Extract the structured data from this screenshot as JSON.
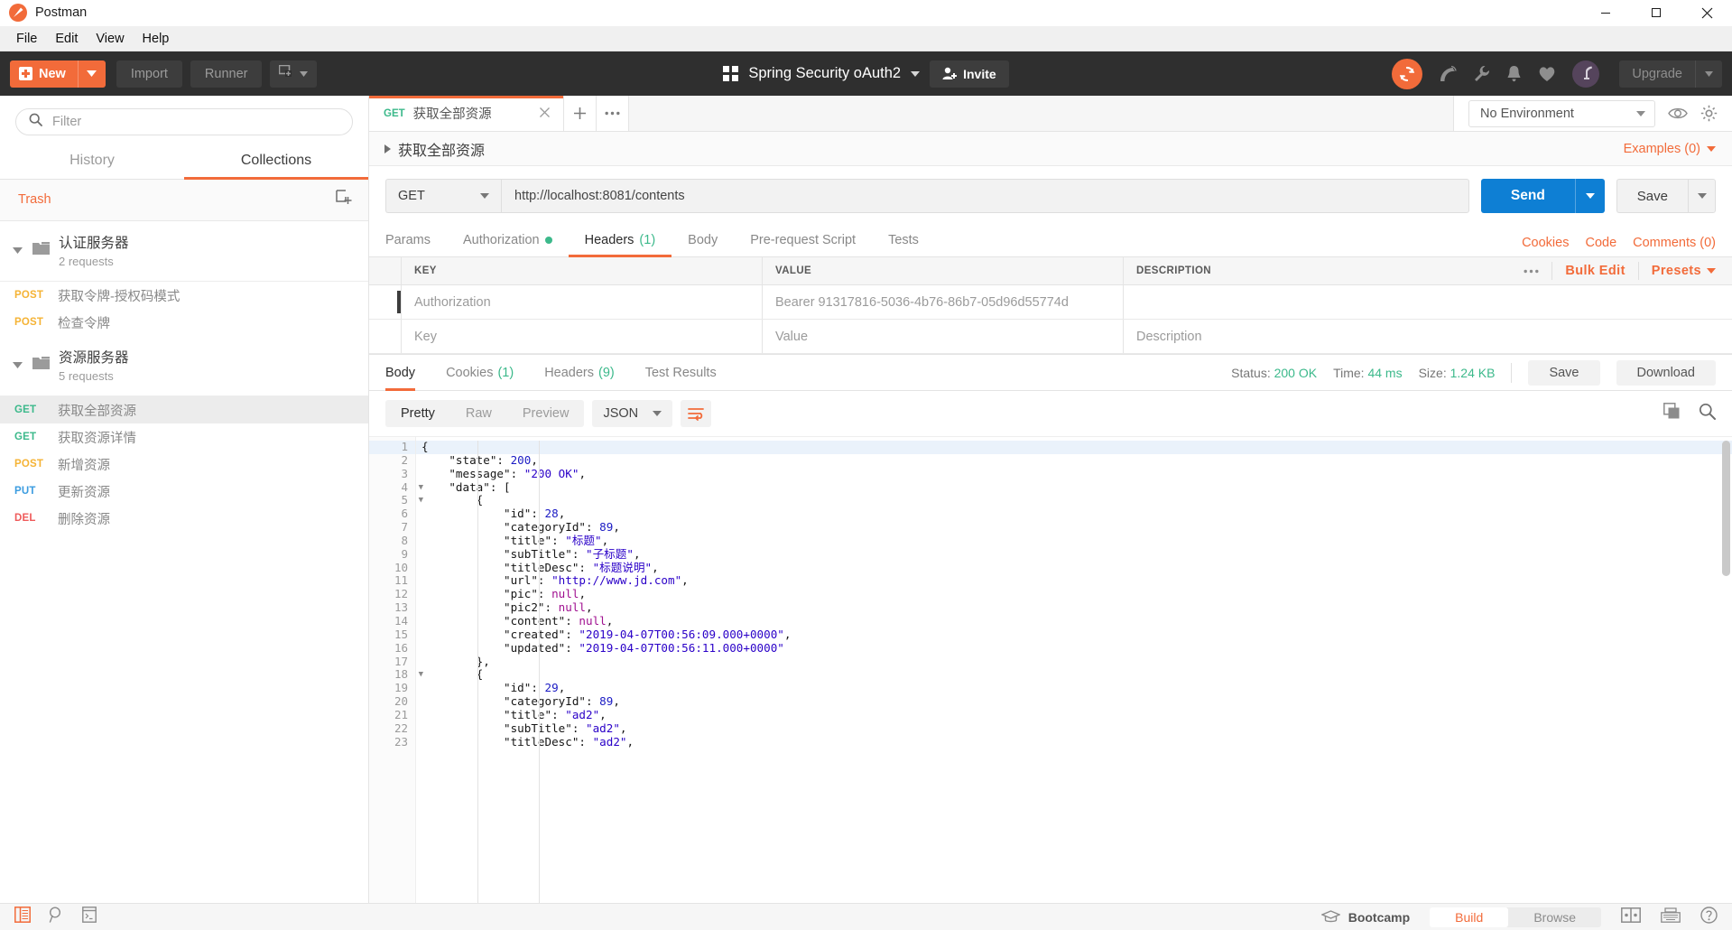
{
  "window": {
    "title": "Postman",
    "minimize_label": "minimize-window",
    "maximize_label": "maximize-window",
    "close_label": "close-window"
  },
  "menubar": {
    "items": [
      "File",
      "Edit",
      "View",
      "Help"
    ]
  },
  "appheader": {
    "new_label": "New",
    "import_label": "Import",
    "runner_label": "Runner",
    "workspace_name": "Spring Security oAuth2",
    "invite_label": "Invite",
    "upgrade_label": "Upgrade"
  },
  "sidebar": {
    "filter_placeholder": "Filter",
    "tabs": [
      {
        "label": "History",
        "active": false
      },
      {
        "label": "Collections",
        "active": true
      }
    ],
    "trash_label": "Trash",
    "collections": [
      {
        "name": "认证服务器",
        "count": "2 requests",
        "requests": [
          {
            "method": "POST",
            "name": "获取令牌-授权码模式",
            "active": false
          },
          {
            "method": "POST",
            "name": "检查令牌",
            "active": false
          }
        ]
      },
      {
        "name": "资源服务器",
        "count": "5 requests",
        "requests": [
          {
            "method": "GET",
            "name": "获取全部资源",
            "active": true
          },
          {
            "method": "GET",
            "name": "获取资源详情",
            "active": false
          },
          {
            "method": "POST",
            "name": "新增资源",
            "active": false
          },
          {
            "method": "PUT",
            "name": "更新资源",
            "active": false
          },
          {
            "method": "DEL",
            "name": "删除资源",
            "active": false
          }
        ]
      }
    ]
  },
  "tabstrip": {
    "open_tab": {
      "method": "GET",
      "name": "获取全部资源"
    },
    "new_tab_label": "+",
    "more_label": "•••",
    "environment": "No Environment"
  },
  "request": {
    "name": "获取全部资源",
    "examples_label": "Examples (0)",
    "method": "GET",
    "url": "http://localhost:8081/contents",
    "send_label": "Send",
    "save_label": "Save",
    "tabs": [
      {
        "label": "Params",
        "active": false,
        "dot": false,
        "count": ""
      },
      {
        "label": "Authorization",
        "active": false,
        "dot": true,
        "count": ""
      },
      {
        "label": "Headers",
        "active": true,
        "dot": false,
        "count": "(1)"
      },
      {
        "label": "Body",
        "active": false,
        "dot": false,
        "count": ""
      },
      {
        "label": "Pre-request Script",
        "active": false,
        "dot": false,
        "count": ""
      },
      {
        "label": "Tests",
        "active": false,
        "dot": false,
        "count": ""
      }
    ],
    "links": [
      "Cookies",
      "Code",
      "Comments (0)"
    ],
    "headers_table": {
      "columns": [
        "KEY",
        "VALUE",
        "DESCRIPTION"
      ],
      "actions": {
        "more": "•••",
        "bulk_edit": "Bulk Edit",
        "presets": "Presets"
      },
      "rows": [
        {
          "key": "Authorization",
          "value": "Bearer 91317816-5036-4b76-86b7-05d96d55774d",
          "description": "",
          "filled": true
        },
        {
          "key": "Key",
          "value": "Value",
          "description": "Description",
          "filled": false
        }
      ]
    }
  },
  "response": {
    "tabs": [
      {
        "label": "Body",
        "count": "",
        "active": true
      },
      {
        "label": "Cookies",
        "count": "(1)",
        "active": false
      },
      {
        "label": "Headers",
        "count": "(9)",
        "active": false
      },
      {
        "label": "Test Results",
        "count": "",
        "active": false
      }
    ],
    "status_label": "Status:",
    "status_value": "200 OK",
    "time_label": "Time:",
    "time_value": "44 ms",
    "size_label": "Size:",
    "size_value": "1.24 KB",
    "save_label": "Save",
    "download_label": "Download",
    "view_modes": [
      {
        "label": "Pretty",
        "active": true
      },
      {
        "label": "Raw",
        "active": false
      },
      {
        "label": "Preview",
        "active": false
      }
    ],
    "format": "JSON",
    "body_lines": [
      {
        "n": 1,
        "fold": true,
        "indent": 0,
        "tokens": [
          {
            "t": "p",
            "v": "{"
          }
        ]
      },
      {
        "n": 2,
        "fold": false,
        "indent": 1,
        "tokens": [
          {
            "t": "k",
            "v": "\"state\""
          },
          {
            "t": "p",
            "v": ": "
          },
          {
            "t": "n",
            "v": "200"
          },
          {
            "t": "p",
            "v": ","
          }
        ]
      },
      {
        "n": 3,
        "fold": false,
        "indent": 1,
        "tokens": [
          {
            "t": "k",
            "v": "\"message\""
          },
          {
            "t": "p",
            "v": ": "
          },
          {
            "t": "s",
            "v": "\"200 OK\""
          },
          {
            "t": "p",
            "v": ","
          }
        ]
      },
      {
        "n": 4,
        "fold": true,
        "indent": 1,
        "tokens": [
          {
            "t": "k",
            "v": "\"data\""
          },
          {
            "t": "p",
            "v": ": ["
          }
        ]
      },
      {
        "n": 5,
        "fold": true,
        "indent": 2,
        "tokens": [
          {
            "t": "p",
            "v": "{"
          }
        ]
      },
      {
        "n": 6,
        "fold": false,
        "indent": 3,
        "tokens": [
          {
            "t": "k",
            "v": "\"id\""
          },
          {
            "t": "p",
            "v": ": "
          },
          {
            "t": "n",
            "v": "28"
          },
          {
            "t": "p",
            "v": ","
          }
        ]
      },
      {
        "n": 7,
        "fold": false,
        "indent": 3,
        "tokens": [
          {
            "t": "k",
            "v": "\"categoryId\""
          },
          {
            "t": "p",
            "v": ": "
          },
          {
            "t": "n",
            "v": "89"
          },
          {
            "t": "p",
            "v": ","
          }
        ]
      },
      {
        "n": 8,
        "fold": false,
        "indent": 3,
        "tokens": [
          {
            "t": "k",
            "v": "\"title\""
          },
          {
            "t": "p",
            "v": ": "
          },
          {
            "t": "s",
            "v": "\"标题\""
          },
          {
            "t": "p",
            "v": ","
          }
        ]
      },
      {
        "n": 9,
        "fold": false,
        "indent": 3,
        "tokens": [
          {
            "t": "k",
            "v": "\"subTitle\""
          },
          {
            "t": "p",
            "v": ": "
          },
          {
            "t": "s",
            "v": "\"子标题\""
          },
          {
            "t": "p",
            "v": ","
          }
        ]
      },
      {
        "n": 10,
        "fold": false,
        "indent": 3,
        "tokens": [
          {
            "t": "k",
            "v": "\"titleDesc\""
          },
          {
            "t": "p",
            "v": ": "
          },
          {
            "t": "s",
            "v": "\"标题说明\""
          },
          {
            "t": "p",
            "v": ","
          }
        ]
      },
      {
        "n": 11,
        "fold": false,
        "indent": 3,
        "tokens": [
          {
            "t": "k",
            "v": "\"url\""
          },
          {
            "t": "p",
            "v": ": "
          },
          {
            "t": "s",
            "v": "\"http://www.jd.com\""
          },
          {
            "t": "p",
            "v": ","
          }
        ]
      },
      {
        "n": 12,
        "fold": false,
        "indent": 3,
        "tokens": [
          {
            "t": "k",
            "v": "\"pic\""
          },
          {
            "t": "p",
            "v": ": "
          },
          {
            "t": "nl",
            "v": "null"
          },
          {
            "t": "p",
            "v": ","
          }
        ]
      },
      {
        "n": 13,
        "fold": false,
        "indent": 3,
        "tokens": [
          {
            "t": "k",
            "v": "\"pic2\""
          },
          {
            "t": "p",
            "v": ": "
          },
          {
            "t": "nl",
            "v": "null"
          },
          {
            "t": "p",
            "v": ","
          }
        ]
      },
      {
        "n": 14,
        "fold": false,
        "indent": 3,
        "tokens": [
          {
            "t": "k",
            "v": "\"content\""
          },
          {
            "t": "p",
            "v": ": "
          },
          {
            "t": "nl",
            "v": "null"
          },
          {
            "t": "p",
            "v": ","
          }
        ]
      },
      {
        "n": 15,
        "fold": false,
        "indent": 3,
        "tokens": [
          {
            "t": "k",
            "v": "\"created\""
          },
          {
            "t": "p",
            "v": ": "
          },
          {
            "t": "s",
            "v": "\"2019-04-07T00:56:09.000+0000\""
          },
          {
            "t": "p",
            "v": ","
          }
        ]
      },
      {
        "n": 16,
        "fold": false,
        "indent": 3,
        "tokens": [
          {
            "t": "k",
            "v": "\"updated\""
          },
          {
            "t": "p",
            "v": ": "
          },
          {
            "t": "s",
            "v": "\"2019-04-07T00:56:11.000+0000\""
          }
        ]
      },
      {
        "n": 17,
        "fold": false,
        "indent": 2,
        "tokens": [
          {
            "t": "p",
            "v": "},"
          }
        ]
      },
      {
        "n": 18,
        "fold": true,
        "indent": 2,
        "tokens": [
          {
            "t": "p",
            "v": "{"
          }
        ]
      },
      {
        "n": 19,
        "fold": false,
        "indent": 3,
        "tokens": [
          {
            "t": "k",
            "v": "\"id\""
          },
          {
            "t": "p",
            "v": ": "
          },
          {
            "t": "n",
            "v": "29"
          },
          {
            "t": "p",
            "v": ","
          }
        ]
      },
      {
        "n": 20,
        "fold": false,
        "indent": 3,
        "tokens": [
          {
            "t": "k",
            "v": "\"categoryId\""
          },
          {
            "t": "p",
            "v": ": "
          },
          {
            "t": "n",
            "v": "89"
          },
          {
            "t": "p",
            "v": ","
          }
        ]
      },
      {
        "n": 21,
        "fold": false,
        "indent": 3,
        "tokens": [
          {
            "t": "k",
            "v": "\"title\""
          },
          {
            "t": "p",
            "v": ": "
          },
          {
            "t": "s",
            "v": "\"ad2\""
          },
          {
            "t": "p",
            "v": ","
          }
        ]
      },
      {
        "n": 22,
        "fold": false,
        "indent": 3,
        "tokens": [
          {
            "t": "k",
            "v": "\"subTitle\""
          },
          {
            "t": "p",
            "v": ": "
          },
          {
            "t": "s",
            "v": "\"ad2\""
          },
          {
            "t": "p",
            "v": ","
          }
        ]
      },
      {
        "n": 23,
        "fold": false,
        "indent": 3,
        "tokens": [
          {
            "t": "k",
            "v": "\"titleDesc\""
          },
          {
            "t": "p",
            "v": ": "
          },
          {
            "t": "s",
            "v": "\"ad2\""
          },
          {
            "t": "p",
            "v": ","
          }
        ]
      }
    ]
  },
  "footer": {
    "bootcamp_label": "Bootcamp",
    "modes": [
      {
        "label": "Build",
        "active": true
      },
      {
        "label": "Browse",
        "active": false
      }
    ]
  },
  "colors": {
    "accent": "#f26b3a",
    "send_blue": "#0e7fd4",
    "green": "#3cb98b",
    "header_dark": "#2f2f2f"
  }
}
